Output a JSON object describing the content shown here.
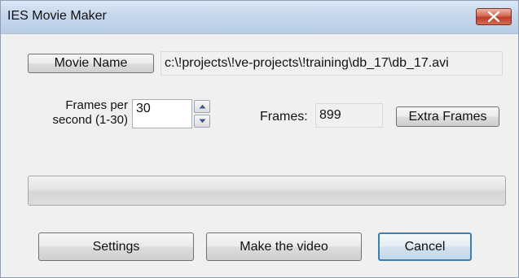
{
  "window": {
    "title": "IES Movie Maker"
  },
  "movie": {
    "button_label": "Movie Name",
    "path": "c:\\!projects\\!ve-projects\\!training\\db_17\\db_17.avi"
  },
  "fps": {
    "label_line1": "Frames per",
    "label_line2": "second (1-30)",
    "value": "30"
  },
  "frames": {
    "label": "Frames:",
    "value": "899",
    "extra_button_label": "Extra Frames"
  },
  "progress": {
    "value_percent": 0
  },
  "buttons": {
    "settings_label": "Settings",
    "make_video_label": "Make the video",
    "cancel_label": "Cancel"
  },
  "icons": {
    "close": "close-icon",
    "spin_up": "chevron-up-icon",
    "spin_down": "chevron-down-icon"
  },
  "colors": {
    "close_button": "#c8473a",
    "focus_border": "#3c7fb1",
    "dialog_background": "#f0f0f0"
  }
}
